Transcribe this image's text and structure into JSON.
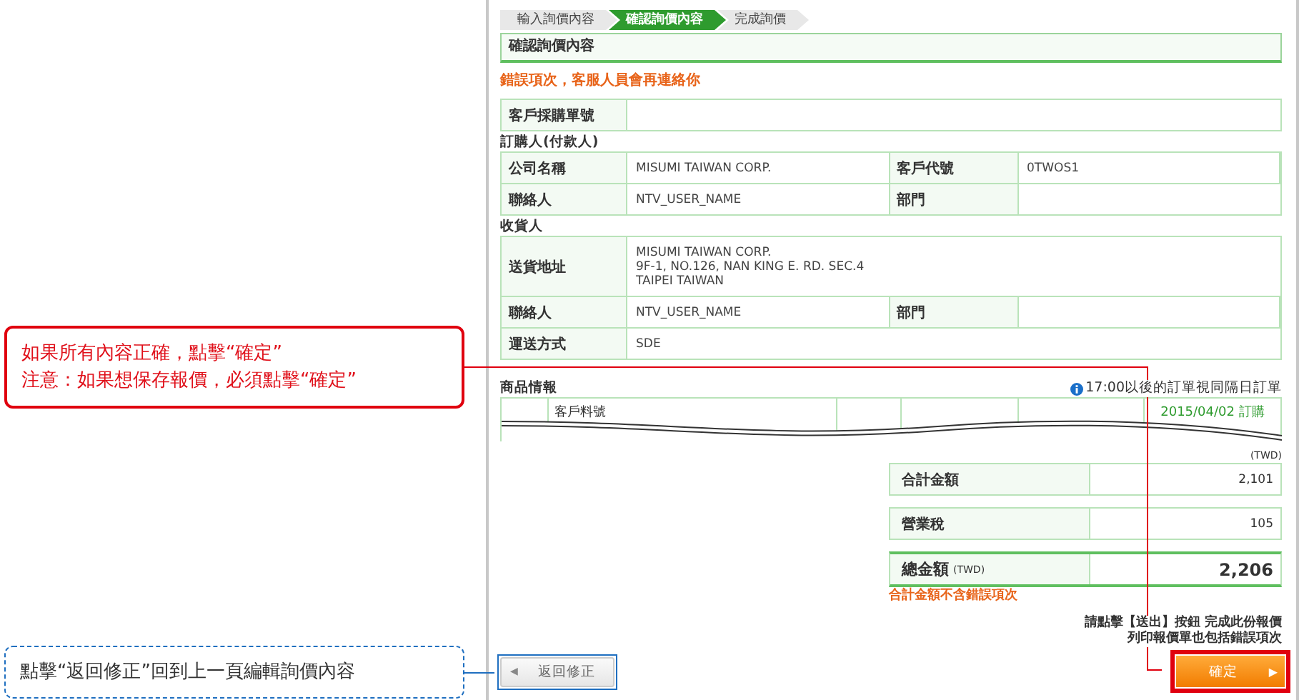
{
  "annotations": [
    {
      "kind": "confirm",
      "lines": [
        "如果所有內容正確，點擊“確定”",
        "注意：如果想保存報價，必須點擊“確定”"
      ]
    },
    {
      "kind": "back",
      "lines": [
        "點擊“返回修正”回到上一頁編輯詢價內容"
      ]
    }
  ],
  "steps": [
    {
      "label": "輸入詢價內容",
      "selected": false
    },
    {
      "label": "確認詢價內容",
      "selected": true
    },
    {
      "label": "完成詢價",
      "selected": false
    }
  ],
  "page_title": "確認詢價內容",
  "error_notice": "錯誤項次，客服人員會再連絡你",
  "po_field": {
    "label": "客戶採購單號"
  },
  "buyer": {
    "title": "訂購人(付款人)",
    "rows": [
      [
        {
          "label": "公司名稱",
          "value": "MISUMI TAIWAN CORP."
        },
        {
          "label": "客戶代號",
          "value": "0TWOS1"
        }
      ],
      [
        {
          "label": "聯絡人",
          "value": "NTV_USER_NAME"
        },
        {
          "label": "部門"
        }
      ]
    ]
  },
  "receiver": {
    "title": "收貨人",
    "rows": [
      [
        {
          "label": "送貨地址",
          "value_lines": [
            "MISUMI TAIWAN CORP.",
            "9F-1, NO.126, NAN KING E. RD. SEC.4",
            "TAIPEI TAIWAN"
          ]
        }
      ],
      [
        {
          "label": "聯絡人",
          "value": "NTV_USER_NAME"
        },
        {
          "label": "部門"
        }
      ],
      [
        {
          "label": "運送方式",
          "value": "SDE"
        }
      ]
    ]
  },
  "products": {
    "title": "商品情報",
    "notice": "17:00以後的訂單視同隔日訂單",
    "column_2": "客戶料號",
    "column_6": "2015/04/02 訂購"
  },
  "totals": {
    "currency": "(TWD)",
    "rows": [
      {
        "label": "合計金額",
        "value": "2,101"
      },
      {
        "label": "營業稅",
        "value": "105"
      }
    ],
    "total": {
      "label": "總金額",
      "unit": "(TWD)",
      "value": "2,206"
    },
    "note": "合計金額不含錯誤項次"
  },
  "footer_notes": [
    "請點擊【送出】按鈕 完成此份報價",
    "列印報價單也包括錯誤項次"
  ],
  "buttons": {
    "back": {
      "icon": "◀",
      "label": "返回修正"
    },
    "confirm": {
      "label": "確定",
      "icon": "▶"
    }
  }
}
